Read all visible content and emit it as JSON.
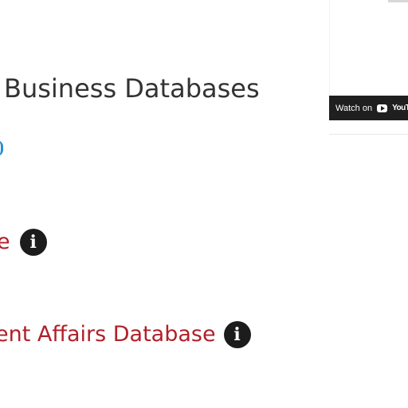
{
  "video_embed": {
    "watch_on_label": "Watch on",
    "youtube_wordmark": "YouTube",
    "youtube_icon": "youtube-play-icon"
  },
  "section": {
    "heading": "Business Databases"
  },
  "databases": [
    {
      "label": "e",
      "info_icon": "info-icon"
    },
    {
      "label": "ent Affairs Database",
      "info_icon": "info-icon"
    }
  ],
  "colors": {
    "heading": "#333333",
    "link": "#b0202a",
    "partial_link_mark": "#2c8cd0",
    "info_icon_background": "#1c1c1c",
    "video_bar": "#1f1f1f"
  }
}
